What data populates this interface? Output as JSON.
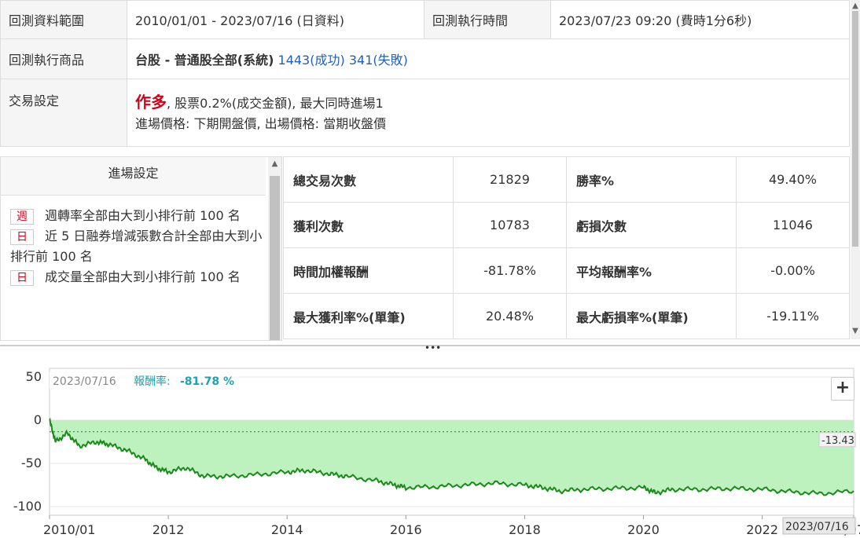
{
  "info": {
    "range_label": "回測資料範圍",
    "range_value": "2010/01/01 - 2023/07/16 (日資料)",
    "exec_time_label": "回測執行時間",
    "exec_time_value": "2023/07/23 09:20 (費時1分6秒)",
    "product_label": "回測執行商品",
    "product_name": "台股 - 普通股全部(系統)",
    "product_success": "1443(成功)",
    "product_fail": "341(失敗)",
    "trade_label": "交易設定",
    "trade_direction": "作多",
    "trade_line1_rest": ", 股票0.2%(成交金額), 最大同時進場1",
    "trade_line2": "進場價格: 下期開盤價, 出場價格: 當期收盤價"
  },
  "entry": {
    "header": "進場設定",
    "conditions": [
      {
        "tag": "週",
        "text": "週轉率全部由大到小排行前 100 名"
      },
      {
        "tag": "日",
        "text": "近 5 日融券增減張數合計全部由大到小排行前 100 名"
      },
      {
        "tag": "日",
        "text": "成交量全部由大到小排行前 100 名"
      }
    ]
  },
  "stats": {
    "rows": [
      {
        "k1": "總交易次數",
        "v1": "21829",
        "k2": "勝率%",
        "v2": "49.40%"
      },
      {
        "k1": "獲利次數",
        "v1": "10783",
        "k2": "虧損次數",
        "v2": "11046"
      },
      {
        "k1": "時間加權報酬",
        "v1": "-81.78%",
        "k2": "平均報酬率%",
        "v2": "-0.00%"
      },
      {
        "k1": "最大獲利率%(單筆)",
        "v1": "20.48%",
        "k2": "最大虧損率%(單筆)",
        "v2": "-19.11%"
      }
    ]
  },
  "chart_data": {
    "type": "area",
    "header_date": "2023/07/16",
    "header_label": "報酬率:",
    "header_value": "-81.78 %",
    "yticks": [
      50,
      0,
      -50,
      -100
    ],
    "xticks": [
      "2010/01",
      "2012",
      "2014",
      "2016",
      "2018",
      "2020",
      "2022",
      "2023/07"
    ],
    "reference_value": -13.43,
    "reference_label": "-13.43",
    "cursor_label": "2023/07/16",
    "ylim": [
      -110,
      60
    ],
    "x": [
      2010.0,
      2010.1,
      2010.3,
      2010.5,
      2010.8,
      2011.0,
      2011.3,
      2011.6,
      2011.8,
      2012.0,
      2012.3,
      2012.6,
      2013.0,
      2013.5,
      2014.0,
      2014.3,
      2014.7,
      2015.0,
      2015.5,
      2015.8,
      2016.0,
      2016.5,
      2017.0,
      2017.5,
      2018.0,
      2018.3,
      2018.6,
      2019.0,
      2019.5,
      2020.0,
      2020.2,
      2020.5,
      2021.0,
      2021.5,
      2022.0,
      2022.5,
      2023.0,
      2023.54
    ],
    "values": [
      0,
      -25,
      -15,
      -30,
      -25,
      -28,
      -35,
      -45,
      -55,
      -60,
      -55,
      -65,
      -65,
      -63,
      -60,
      -58,
      -62,
      -65,
      -70,
      -75,
      -78,
      -77,
      -75,
      -73,
      -75,
      -78,
      -82,
      -80,
      -79,
      -78,
      -84,
      -80,
      -80,
      -79,
      -80,
      -83,
      -85,
      -82
    ]
  }
}
